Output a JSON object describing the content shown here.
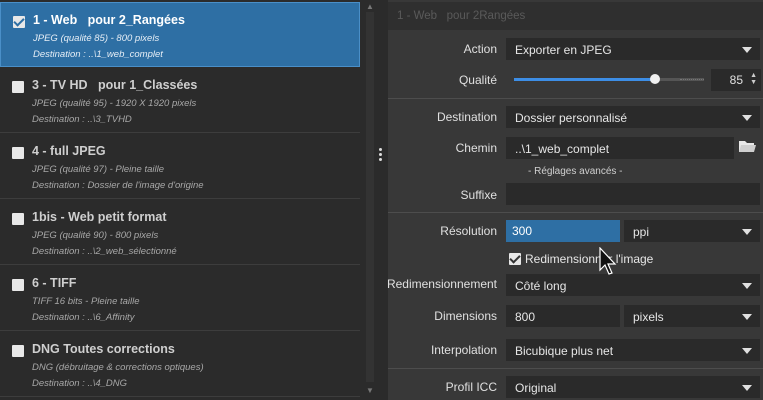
{
  "presets": [
    {
      "title": "1 - Web   pour 2_Rangées",
      "line1": "JPEG (qualité 85) - 800 pixels",
      "line2": "Destination : ..\\1_web_complet",
      "checked": true,
      "selected": true
    },
    {
      "title": "3 - TV HD   pour 1_Classées",
      "line1": "JPEG (qualité 95) - 1920 X 1920 pixels",
      "line2": "Destination : ..\\3_TVHD",
      "checked": false,
      "selected": false
    },
    {
      "title": "4 - full JPEG",
      "line1": "JPEG (qualité 97) - Pleine taille",
      "line2": "Destination : Dossier de l'image d'origine",
      "checked": false,
      "selected": false
    },
    {
      "title": "1bis - Web petit format",
      "line1": "JPEG (qualité 90) - 800 pixels",
      "line2": "Destination : ..\\2_web_sélectionné",
      "checked": false,
      "selected": false
    },
    {
      "title": "6 - TIFF",
      "line1": "TIFF 16 bits - Pleine taille",
      "line2": "Destination : ..\\6_Affinity",
      "checked": false,
      "selected": false
    },
    {
      "title": "DNG Toutes corrections",
      "line1": "DNG (débruitage & corrections optiques)",
      "line2": "Destination : ..\\4_DNG",
      "checked": false,
      "selected": false
    }
  ],
  "settings": {
    "header": "1 - Web   pour 2Rangées",
    "action_label": "Action",
    "action_value": "Exporter en JPEG",
    "quality_label": "Qualité",
    "quality_value": "85",
    "quality_fraction": 0.85,
    "destination_label": "Destination",
    "destination_value": "Dossier personnalisé",
    "path_label": "Chemin",
    "path_value": "..\\1_web_complet",
    "advanced_label": "- Réglages avancés -",
    "suffix_label": "Suffixe",
    "suffix_value": "",
    "resolution_label": "Résolution",
    "resolution_value": "300",
    "resolution_unit": "ppi",
    "resize_checkbox_label": "Redimensionner l'image",
    "resize_label": "Redimensionnement",
    "resize_value": "Côté long",
    "dimensions_label": "Dimensions",
    "dimensions_value": "800",
    "dimensions_unit": "pixels",
    "interpolation_label": "Interpolation",
    "interpolation_value": "Bicubique plus net",
    "icc_label": "Profil ICC",
    "icc_value": "Original"
  },
  "colors": {
    "selected": "#2e6fa4",
    "slider": "#3d8ee6"
  },
  "icons": {
    "folder": "folder-icon",
    "cursor": "mouse-cursor-icon",
    "check": "checkmark-icon"
  }
}
